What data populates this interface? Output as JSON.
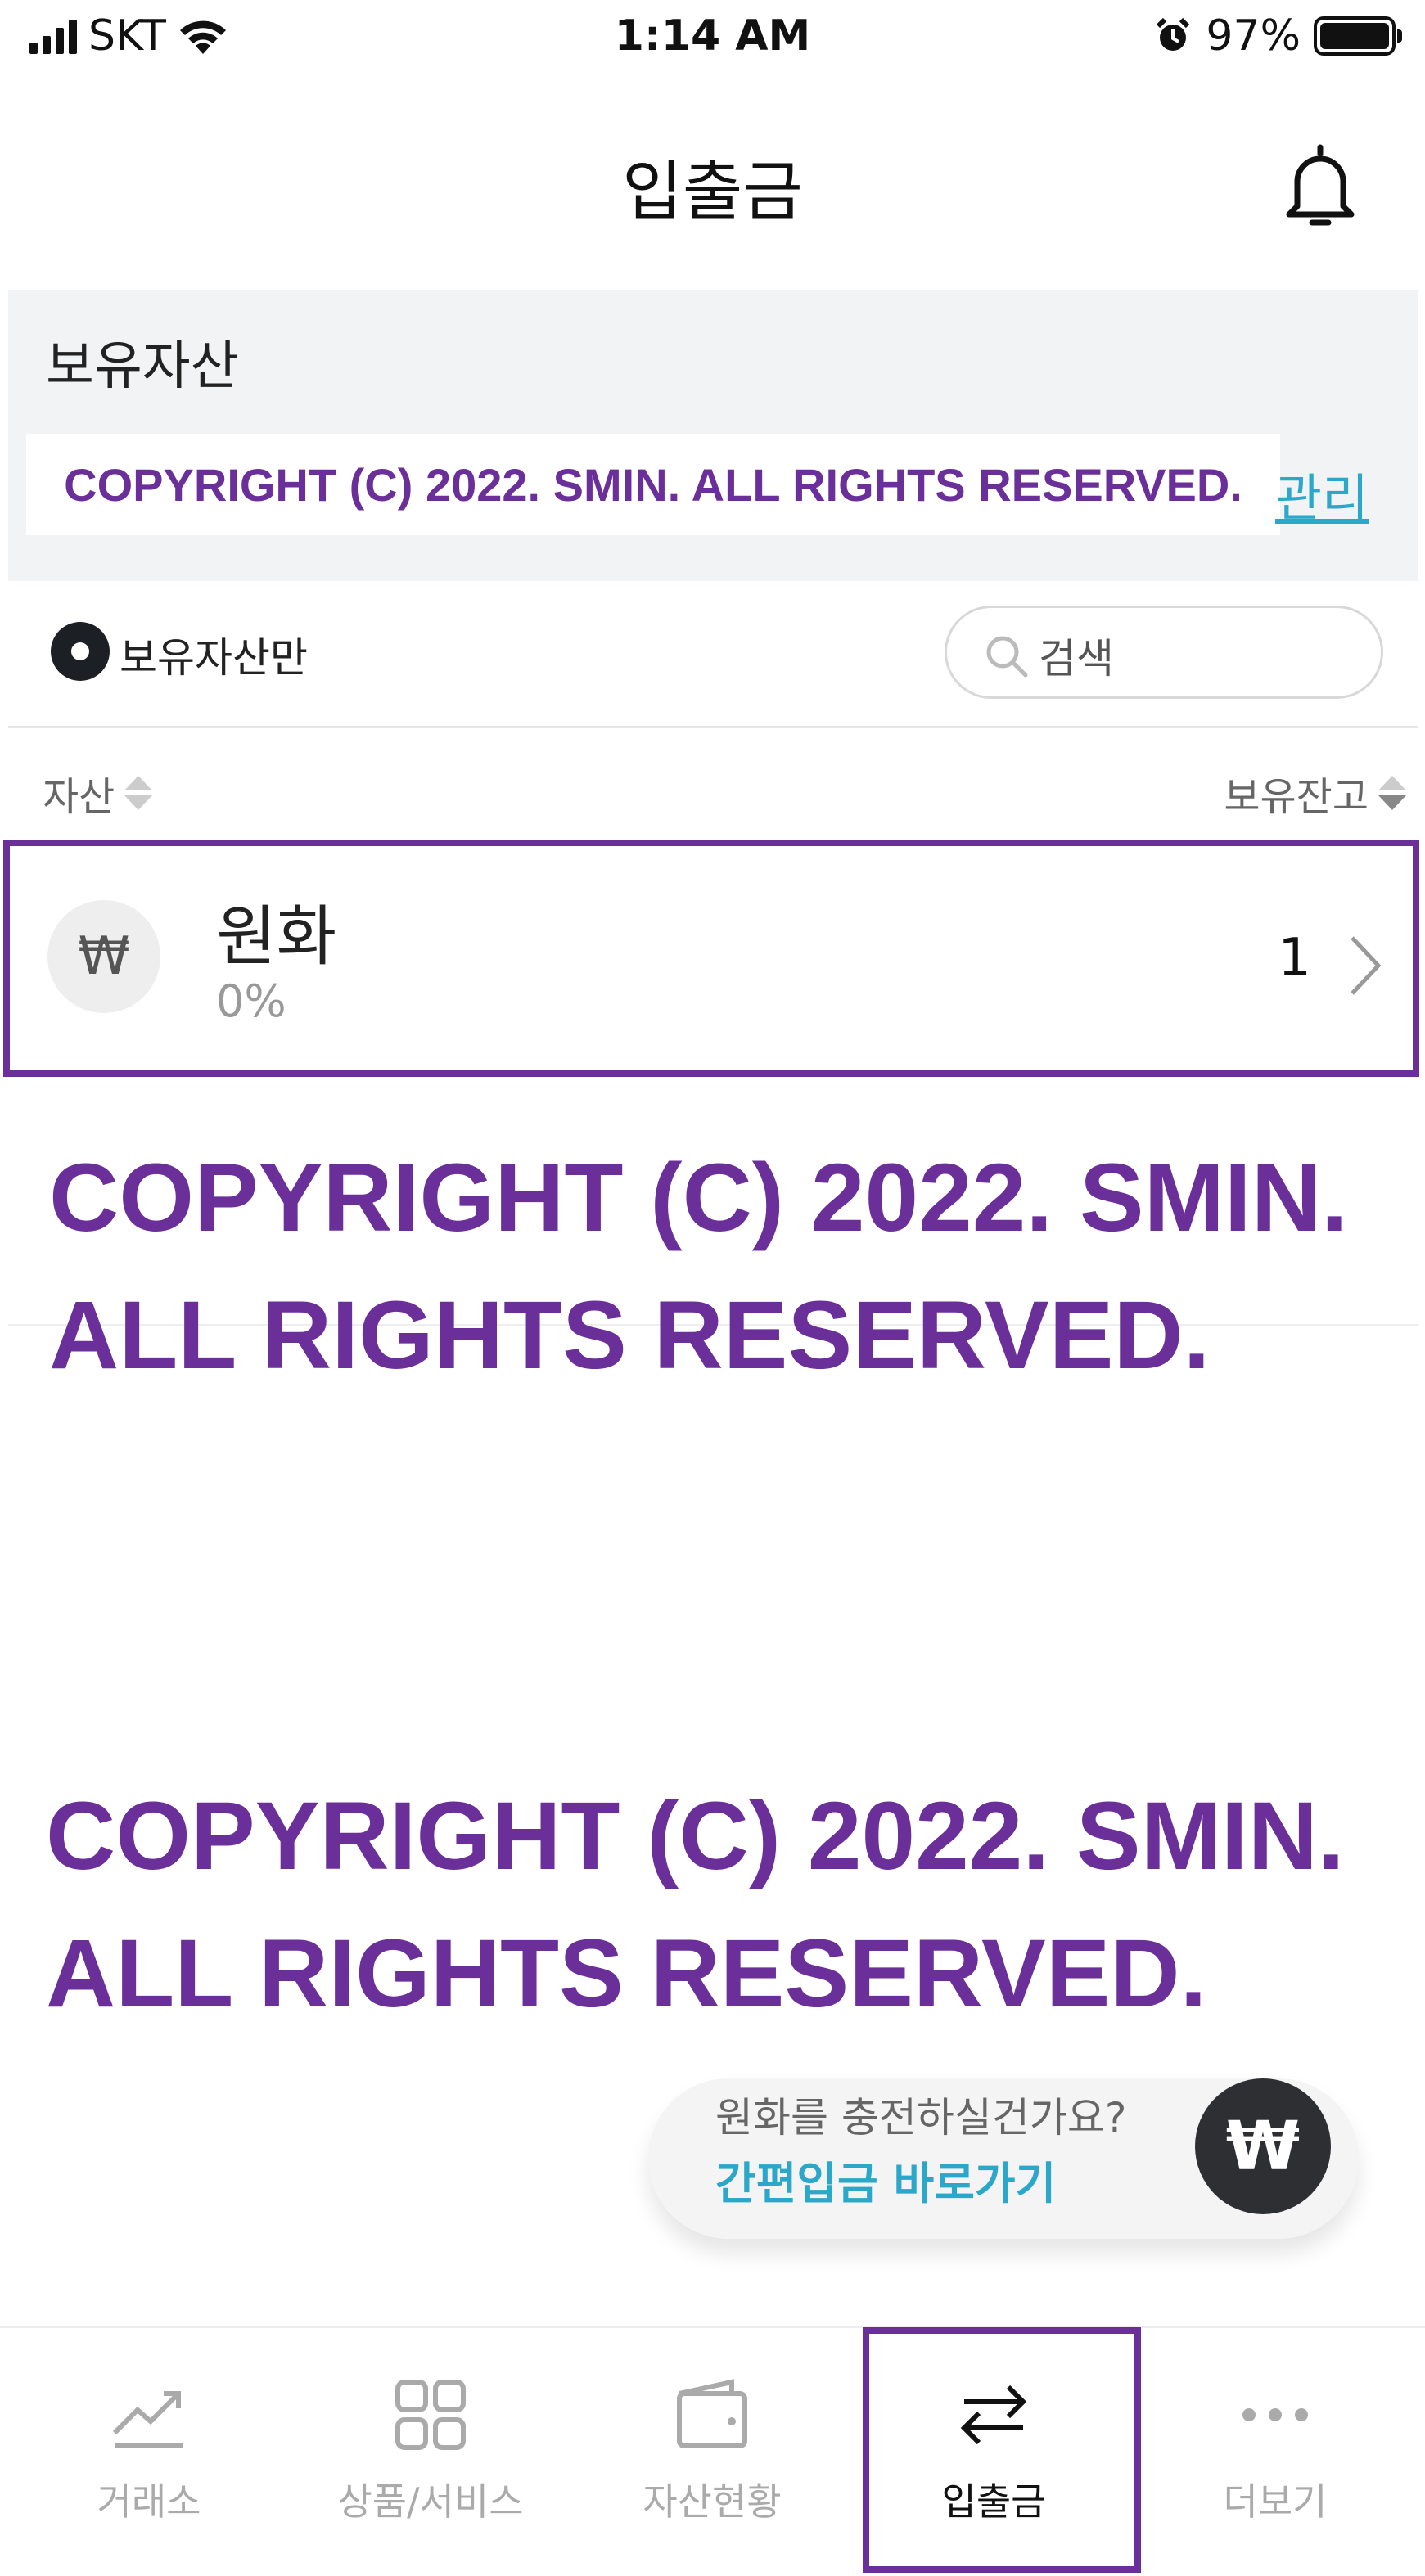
{
  "status_bar": {
    "carrier": "SKT",
    "time": "1:14 AM",
    "battery_percent": "97%"
  },
  "header": {
    "title": "입출금"
  },
  "holdings": {
    "title": "보유자산",
    "copyright_banner": "COPYRIGHT (C) 2022. SMIN. ALL RIGHTS RESERVED.",
    "manage_link": "관리"
  },
  "filter": {
    "holdings_only_label": "보유자산만",
    "search_placeholder": "검색"
  },
  "columns": {
    "asset": "자산",
    "balance": "보유잔고"
  },
  "assets": [
    {
      "symbol": "₩",
      "name": "원화",
      "percent": "0%",
      "balance": "1"
    }
  ],
  "watermarks": [
    {
      "line1": "COPYRIGHT (C) 2022. SMIN.",
      "line2": "ALL RIGHTS RESERVED."
    },
    {
      "line1": "COPYRIGHT (C) 2022. SMIN.",
      "line2": "ALL RIGHTS RESERVED."
    }
  ],
  "deposit_prompt": {
    "question": "원화를 충전하실건가요?",
    "link": "간편입금 바로가기",
    "button_symbol": "₩"
  },
  "tabs": [
    {
      "label": "거래소",
      "icon": "trend-chart-icon"
    },
    {
      "label": "상품/서비스",
      "icon": "grid-icon"
    },
    {
      "label": "자산현황",
      "icon": "wallet-icon"
    },
    {
      "label": "입출금",
      "icon": "transfer-arrows-icon",
      "active": true
    },
    {
      "label": "더보기",
      "icon": "more-dots-icon"
    }
  ],
  "colors": {
    "accent": "#2aa7c9",
    "watermark": "#6b2f9a",
    "panel_bg": "#f2f3f5"
  }
}
